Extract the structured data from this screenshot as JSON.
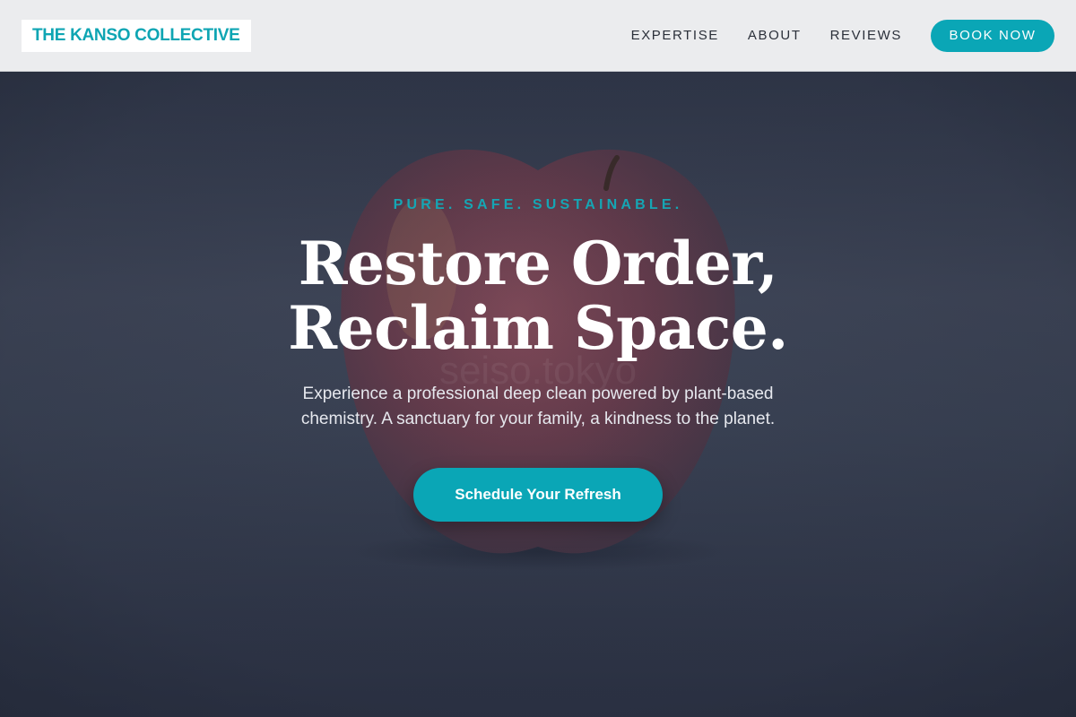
{
  "header": {
    "logo_text": "THE KANSO COLLECTIVE",
    "nav": [
      {
        "label": "EXPERTISE"
      },
      {
        "label": "ABOUT"
      },
      {
        "label": "REVIEWS"
      }
    ],
    "book_label": "BOOK NOW"
  },
  "hero": {
    "background_image": "apple-photo",
    "watermark_text": "seiso.tokyo",
    "eyebrow": "PURE. SAFE. SUSTAINABLE.",
    "headline_line1": "Restore Order,",
    "headline_line2": "Reclaim Space.",
    "subline": "Experience a professional deep clean powered by plant-based chemistry. A sanctuary for your family, a kindness to the planet.",
    "cta_label": "Schedule Your Refresh"
  },
  "colors": {
    "accent": "#0aa6b6",
    "header_bg": "#ebecee",
    "hero_bg": "#3a4254"
  }
}
